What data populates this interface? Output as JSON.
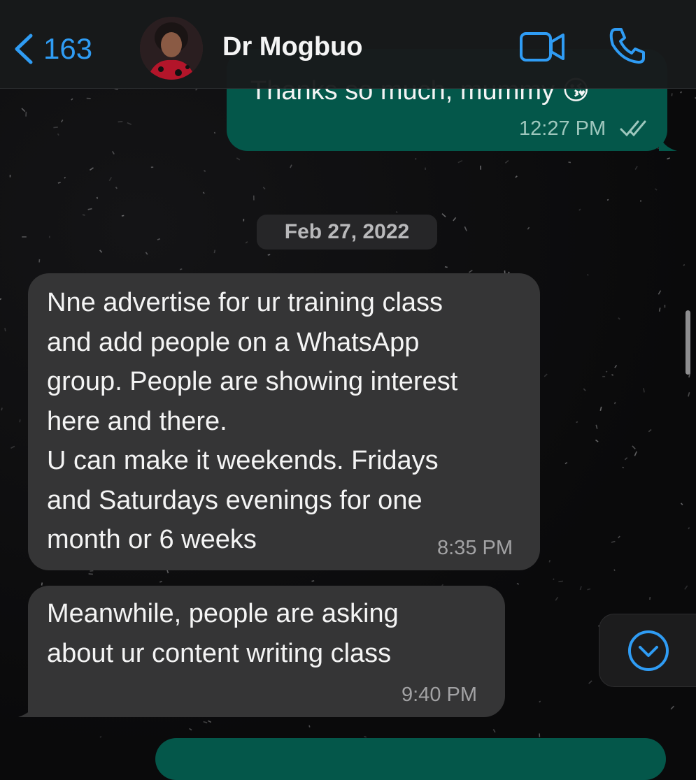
{
  "header": {
    "back_count": "163",
    "contact_name": "Dr Mogbuo",
    "icons": {
      "back": "chevron-left-icon",
      "video": "video-camera-icon",
      "call": "phone-icon"
    },
    "accent_color": "#2f9cf4"
  },
  "messages": [
    {
      "direction": "outgoing",
      "text": "Thanks so much, mummy 😘",
      "time": "12:27 PM",
      "status": "read",
      "status_icon": "double-check-icon"
    },
    {
      "direction": "incoming",
      "text": "Nne advertise for ur training class\nand add people on a WhatsApp\ngroup. People are showing interest\nhere and there.\nU can make it weekends. Fridays\nand Saturdays evenings for one\nmonth or 6 weeks",
      "time": "8:35 PM"
    },
    {
      "direction": "incoming",
      "text": "Meanwhile, people are asking\nabout ur content writing class",
      "time": "9:40 PM"
    }
  ],
  "date_separator": "Feb 27, 2022",
  "scroll_button_icon": "chevron-down-circle-icon",
  "colors": {
    "outgoing_bubble": "#04574a",
    "incoming_bubble": "#353536"
  }
}
